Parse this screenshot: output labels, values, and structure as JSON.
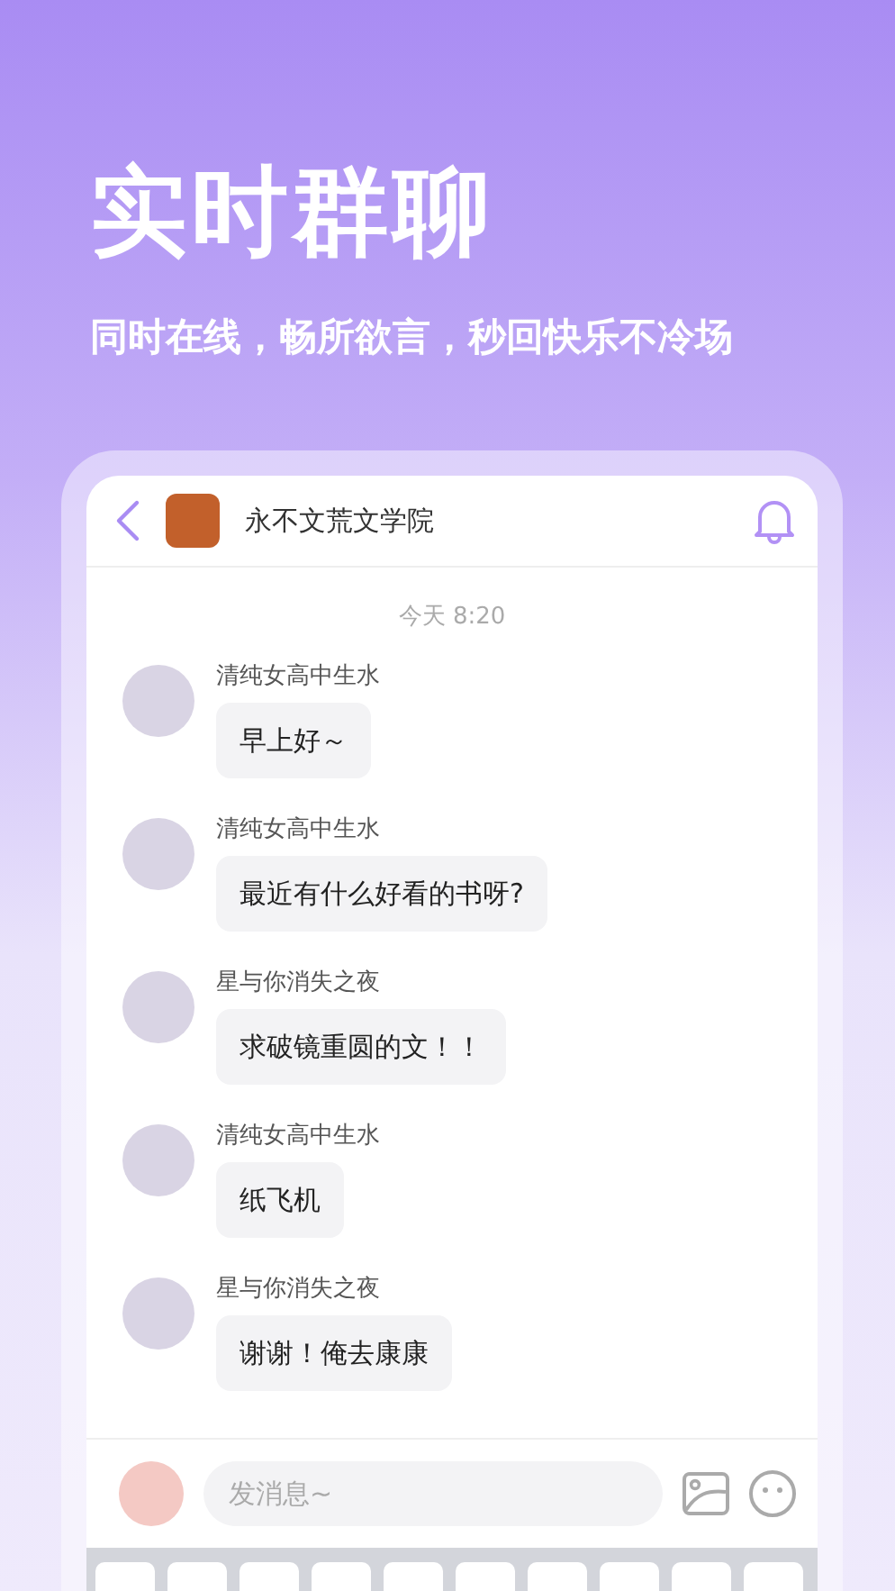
{
  "headline": "实时群聊",
  "subtitle": "同时在线，畅所欲言，秒回快乐不冷场",
  "chat": {
    "title": "永不文荒文学院",
    "timestamp": "今天 8:20",
    "messages": [
      {
        "sender": "清纯女高中生水",
        "text": "早上好～"
      },
      {
        "sender": "清纯女高中生水",
        "text": "最近有什么好看的书呀?"
      },
      {
        "sender": "星与你消失之夜",
        "text": "求破镜重圆的文！！"
      },
      {
        "sender": "清纯女高中生水",
        "text": "纸飞机"
      },
      {
        "sender": "星与你消失之夜",
        "text": "谢谢！俺去康康"
      }
    ],
    "input": {
      "placeholder": "发消息~"
    }
  }
}
